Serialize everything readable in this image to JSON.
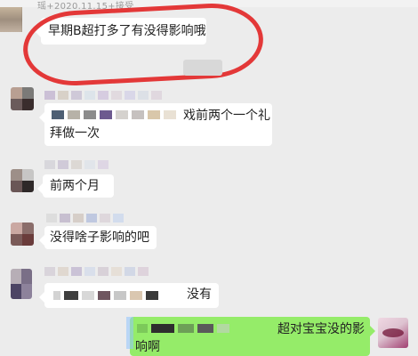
{
  "top": {
    "caption": "瑶+2020.11.15+接受"
  },
  "messages": [
    {
      "text": "早期B超打多了有没得影响哦"
    },
    {
      "line1": "戏前两个一个礼",
      "line2": "拜做一次"
    },
    {
      "text": "前两个月"
    },
    {
      "text": "没得啥子影响的吧"
    },
    {
      "text": "没有"
    },
    {
      "line1": "超对宝宝没的影",
      "line2": "响啊"
    }
  ],
  "colors": {
    "background": "#ececec",
    "incoming_bubble": "#ffffff",
    "outgoing_bubble": "#95ec69",
    "highlight": "#e33838"
  }
}
